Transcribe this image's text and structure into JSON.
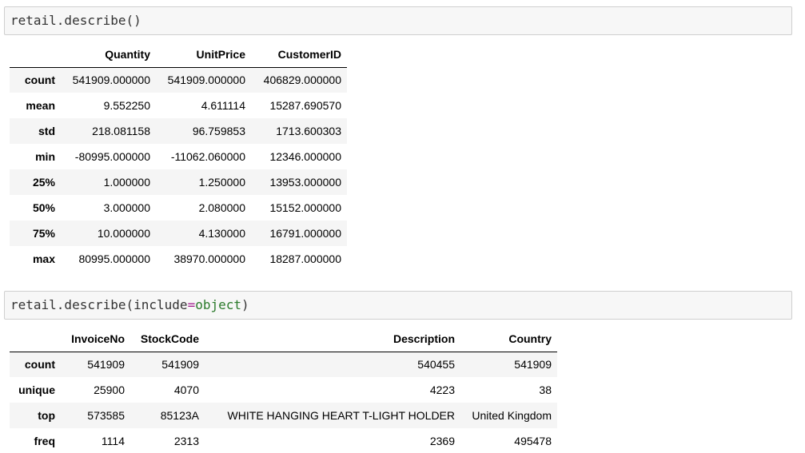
{
  "cells": [
    {
      "code": {
        "prefix": "retail.describe()"
      },
      "table": {
        "columns": [
          "",
          "Quantity",
          "UnitPrice",
          "CustomerID"
        ],
        "rows": [
          {
            "label": "count",
            "values": [
              "541909.000000",
              "541909.000000",
              "406829.000000"
            ]
          },
          {
            "label": "mean",
            "values": [
              "9.552250",
              "4.611114",
              "15287.690570"
            ]
          },
          {
            "label": "std",
            "values": [
              "218.081158",
              "96.759853",
              "1713.600303"
            ]
          },
          {
            "label": "min",
            "values": [
              "-80995.000000",
              "-11062.060000",
              "12346.000000"
            ]
          },
          {
            "label": "25%",
            "values": [
              "1.000000",
              "1.250000",
              "13953.000000"
            ]
          },
          {
            "label": "50%",
            "values": [
              "3.000000",
              "2.080000",
              "15152.000000"
            ]
          },
          {
            "label": "75%",
            "values": [
              "10.000000",
              "4.130000",
              "16791.000000"
            ]
          },
          {
            "label": "max",
            "values": [
              "80995.000000",
              "38970.000000",
              "18287.000000"
            ]
          }
        ]
      }
    },
    {
      "code": {
        "prefix": "retail.describe(include",
        "op": "=",
        "arg": "object",
        "suffix": ")"
      },
      "table": {
        "columns": [
          "",
          "InvoiceNo",
          "StockCode",
          "Description",
          "Country"
        ],
        "rows": [
          {
            "label": "count",
            "values": [
              "541909",
              "541909",
              "540455",
              "541909"
            ]
          },
          {
            "label": "unique",
            "values": [
              "25900",
              "4070",
              "4223",
              "38"
            ]
          },
          {
            "label": "top",
            "values": [
              "573585",
              "85123A",
              "WHITE HANGING HEART T-LIGHT HOLDER",
              "United Kingdom"
            ]
          },
          {
            "label": "freq",
            "values": [
              "1114",
              "2313",
              "2369",
              "495478"
            ]
          }
        ]
      }
    }
  ],
  "colors": {
    "cell_bg": "#f7f7f7",
    "cell_border": "#cfcfcf",
    "row_stripe": "#f5f5f5",
    "keyword_object": "#2a7a2a",
    "operator": "#a2228f"
  }
}
